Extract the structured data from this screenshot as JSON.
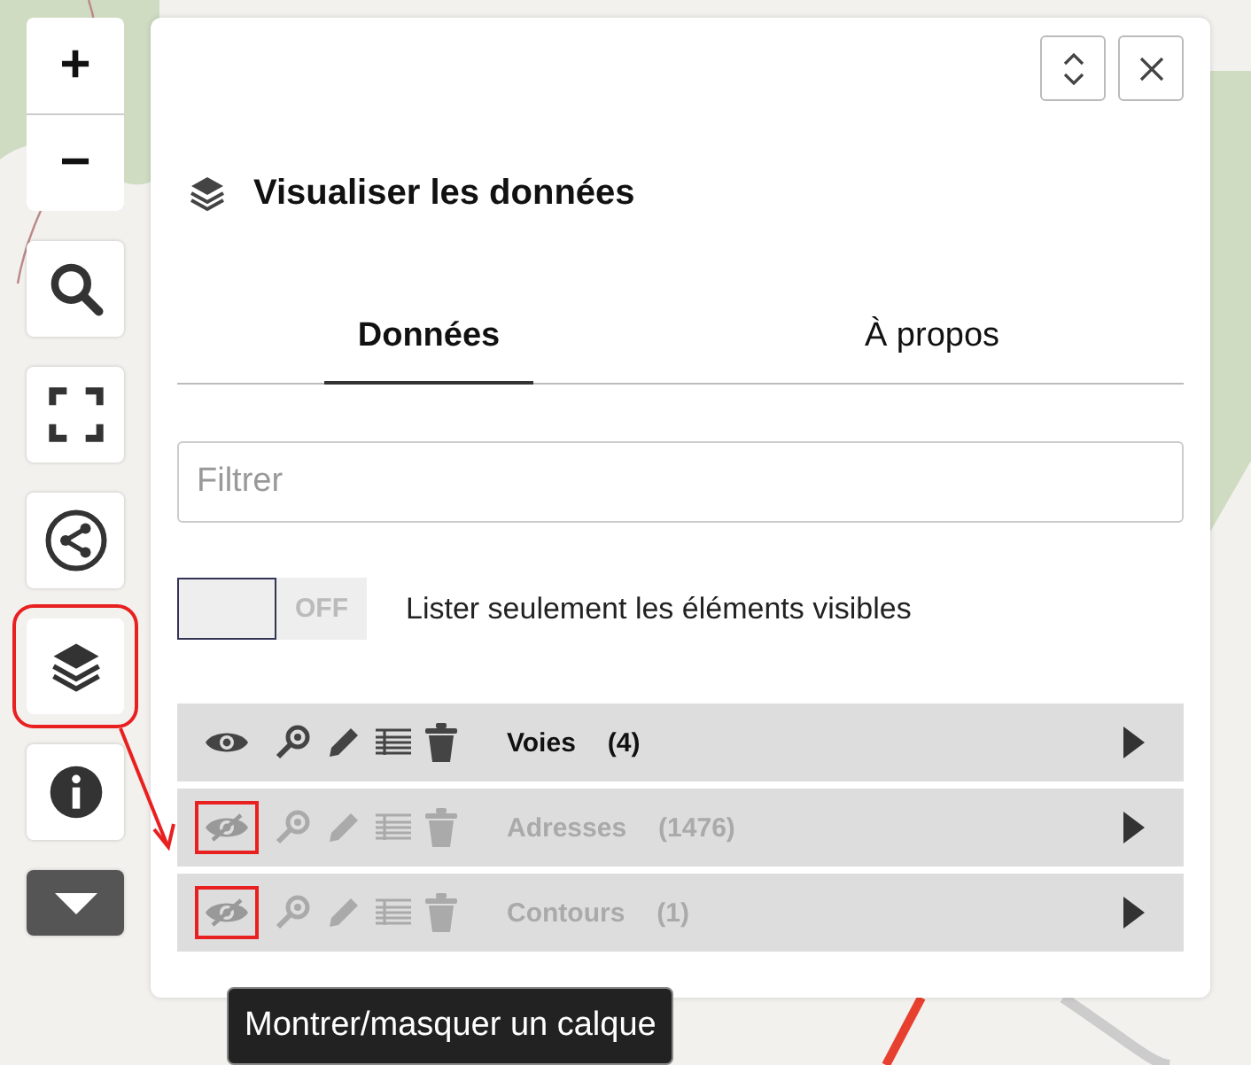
{
  "map_controls": {
    "zoom_in": "+",
    "zoom_out": "−",
    "layers_button_highlighted": true
  },
  "panel": {
    "title": "Visualiser les données",
    "tabs": [
      {
        "label": "Données",
        "selected": true
      },
      {
        "label": "À propos",
        "selected": false
      }
    ],
    "filter": {
      "placeholder": "Filtrer"
    },
    "visible_only_toggle": {
      "on": false,
      "state_label": "OFF",
      "label": "Lister seulement les éléments visibles"
    },
    "layers": [
      {
        "name": "Voies",
        "count": "(4)",
        "visible": true,
        "highlighted": false
      },
      {
        "name": "Adresses",
        "count": "(1476)",
        "visible": false,
        "highlighted": true
      },
      {
        "name": "Contours",
        "count": "(1)",
        "visible": false,
        "highlighted": true
      }
    ]
  },
  "tooltip": {
    "text": "Montrer/masquer un calque"
  }
}
